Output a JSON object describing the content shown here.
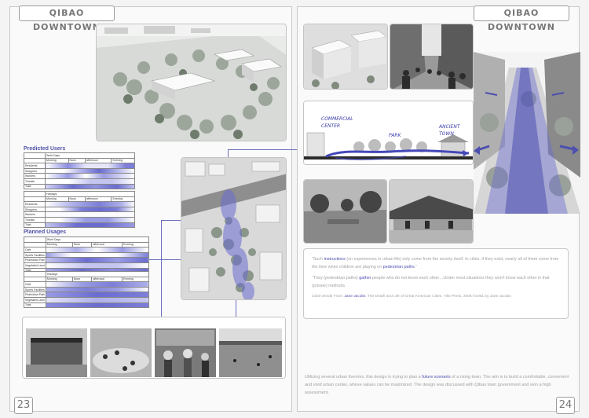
{
  "left_page": {
    "title": "QIBAO DOWNTOWN",
    "page_number": "23",
    "predicted_users": {
      "heading": "Predicted Users",
      "weekday_label": "Work Days",
      "holiday_label": "Holidays",
      "time_cols": [
        "Morning",
        "Noon",
        "afternoon",
        "Evening"
      ],
      "rows": [
        "Residents",
        "Shoppers",
        "Workers",
        "Tourists",
        "Total"
      ]
    },
    "planned_usages": {
      "heading": "Planned Usages",
      "weekday_label": "Work Days",
      "holiday_label": "Holidays",
      "time_cols": [
        "Morning",
        "Noon",
        "afternoon",
        "Evening"
      ],
      "rows": [
        "Cafe",
        "Sports Facilities",
        "Pedestrian Path",
        "Vegetated Land",
        "Total"
      ]
    }
  },
  "right_page": {
    "title": "QIBAO DOWNTOWN",
    "page_number": "24",
    "section_labels": {
      "commercial": "COMMERCIAL CENTER",
      "park": "PARK",
      "ancient": "ANCIENT TOWN"
    },
    "quote1_prefix": "“Such ",
    "quote1_hl1": "instructions",
    "quote1_mid": " (on experiences in urban life) only come from the society itself. In cities, if they exist, nearly all of them come from the time when children are playing on ",
    "quote1_hl2": "pedestrian paths",
    "quote1_suffix": ".”",
    "quote2_prefix": "“They (pedestrian paths) ",
    "quote2_hl": "gather",
    "quote2_suffix": " people who do not know each other…Under most situations they won’t know each other in that (private) methods.",
    "citation_prefix": "Cited Words From: ",
    "citation_author": "Jane Jacobs",
    "citation_rest": ". The Death and Life of Great American Cities. Yilin Press, 2006 ©1961 by Jane Jacobs",
    "summary_prefix": "Utilizing several urban theories, this design is trying to plan a ",
    "summary_hl": "future scenario",
    "summary_rest": " of a rising town. The aim is to build a comfortable, convenient and vivid urban center, whose values can be maximized. The design was discussed with Qibao town government and won a high assessment."
  },
  "colors": {
    "accent": "#5254a8",
    "heat": "#6a6cd0",
    "frame": "#c4c4c4"
  }
}
